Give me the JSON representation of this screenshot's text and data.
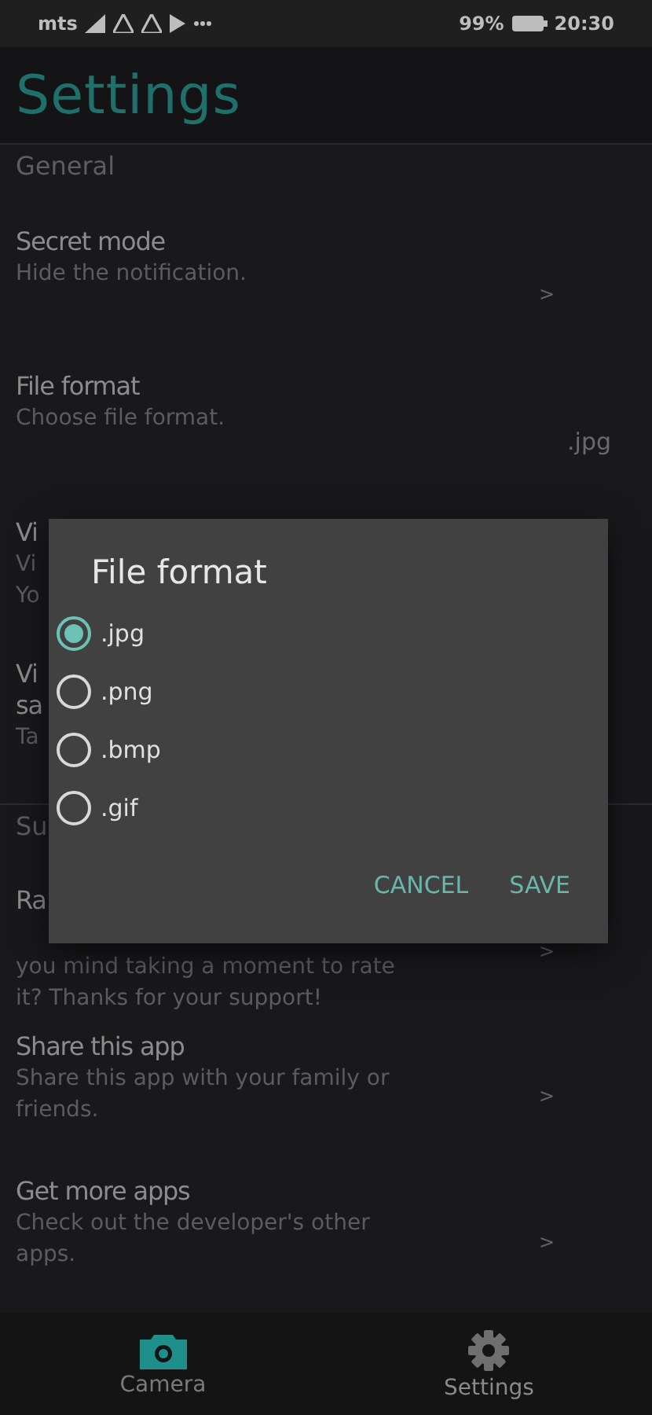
{
  "status_bar": {
    "carrier": "mts",
    "battery": "99%",
    "time": "20:30"
  },
  "header": {
    "title": "Settings"
  },
  "sections": [
    {
      "title": "General",
      "items": [
        {
          "title": [
            "Secret mode"
          ],
          "subtitle": [
            "Hide the notification."
          ],
          "trailing": {
            "kind": "chevron",
            "text": ">"
          }
        },
        {
          "title": [
            "File format"
          ],
          "subtitle": [
            "Choose file format."
          ],
          "trailing": {
            "kind": "value",
            "text": ".jpg"
          }
        },
        {
          "title": [
            "Vi"
          ],
          "subtitle": [
            "Vi",
            "Yo"
          ]
        },
        {
          "title": [
            "Vi",
            "sa"
          ],
          "subtitle": [
            "Ta"
          ]
        }
      ]
    },
    {
      "title": "Su",
      "items": [
        {
          "title": [
            "Ra"
          ],
          "subtitle": [
            "you mind taking a moment to rate",
            "it? Thanks for your support!"
          ],
          "trailing": {
            "kind": "chevron",
            "text": ">"
          }
        },
        {
          "title": [
            "Share this app"
          ],
          "subtitle": [
            "Share this app with your family or",
            "friends."
          ],
          "trailing": {
            "kind": "chevron",
            "text": ">"
          }
        },
        {
          "title": [
            "Get more apps"
          ],
          "subtitle": [
            "Check out the developer's other",
            "apps."
          ],
          "trailing": {
            "kind": "chevron",
            "text": ">"
          }
        }
      ]
    }
  ],
  "dialog": {
    "title": "File format",
    "options": [
      {
        "label": ".jpg",
        "selected": true
      },
      {
        "label": ".png",
        "selected": false
      },
      {
        "label": ".bmp",
        "selected": false
      },
      {
        "label": ".gif",
        "selected": false
      }
    ],
    "buttons": [
      "CANCEL",
      "SAVE"
    ]
  },
  "bottom_nav": [
    {
      "kind": "camera",
      "label": "Camera",
      "selected": true
    },
    {
      "kind": "settings",
      "label": "Settings",
      "selected": false
    }
  ]
}
